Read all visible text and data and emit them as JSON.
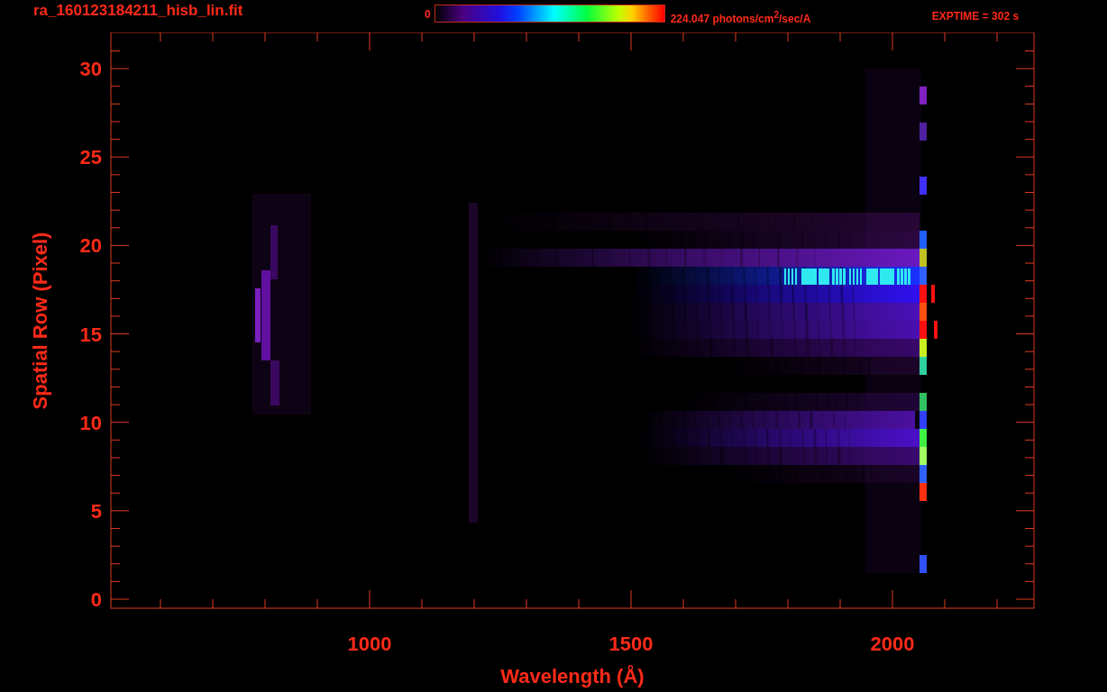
{
  "header": {
    "filename": "ra_160123184211_hisb_lin.fit",
    "colorbar_min": "0",
    "colorbar_max": "224.047 photons/cm$^{2}$/sec/A",
    "exptime": "EXPTIME = 302 s"
  },
  "plot": {
    "xlabel": "Wavelength (Å)",
    "ylabel": "Spatial Row (Pixel)",
    "xticks": [
      "1000",
      "1500",
      "2000"
    ],
    "yticks": [
      "30",
      "25",
      "20",
      "15",
      "10",
      "5",
      "0"
    ]
  }
}
